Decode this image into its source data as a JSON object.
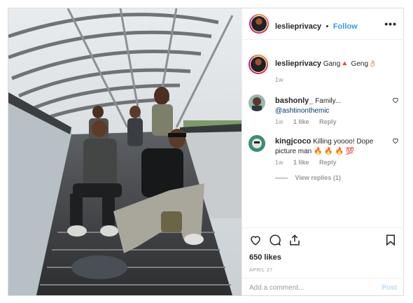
{
  "header": {
    "username": "leslieprivacy",
    "separator": "•",
    "follow_label": "Follow",
    "more": "•••"
  },
  "caption": {
    "username": "leslieprivacy",
    "text": "Gang🔺 Geng👌🏻",
    "age": "1w"
  },
  "comments": [
    {
      "username": "bashonly_",
      "text": "Family...",
      "mention": "@ashtinonthemic",
      "age": "1w",
      "likes": "1 like",
      "reply": "Reply"
    },
    {
      "username": "kingjcoco",
      "text": "Killing yoooo! Dope picture man 🔥 🔥 🔥 💯",
      "age": "1w",
      "likes": "1 like",
      "reply": "Reply",
      "view_replies": "View replies (1)"
    }
  ],
  "actions": {
    "likes": "650 likes",
    "date": "APRIL 27"
  },
  "add_comment": {
    "placeholder": "Add a comment...",
    "post_label": "Post"
  },
  "colors": {
    "link": "#3897f0",
    "post_disabled": "#b3dbff",
    "muted": "#999999"
  }
}
